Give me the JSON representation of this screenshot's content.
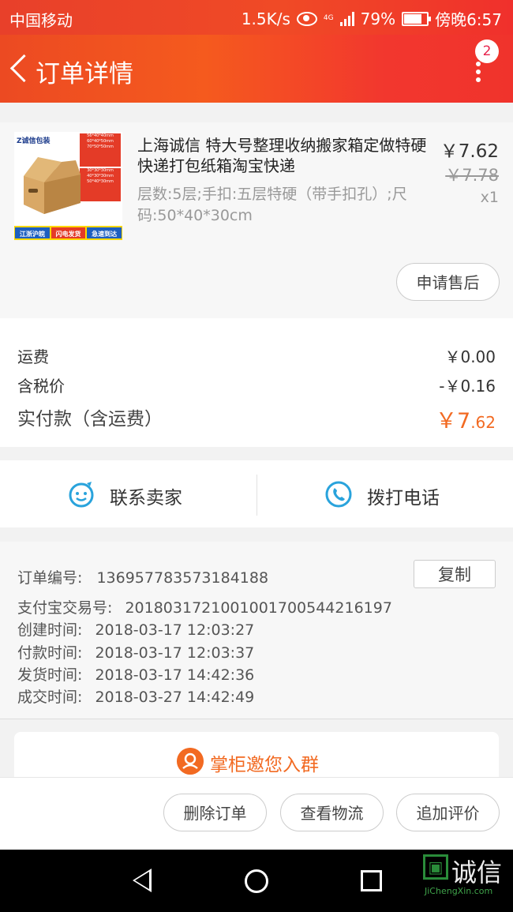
{
  "status_bar": {
    "carrier": "中国移动",
    "speed": "1.5K/s",
    "network": "4G",
    "battery": "79%",
    "time": "傍晚6:57"
  },
  "header": {
    "title": "订单详情",
    "notification_count": "2"
  },
  "product": {
    "image": {
      "brand": "Z诚信包装",
      "badges": [
        "江浙沪皖",
        "闪电发货",
        "急速到达"
      ]
    },
    "name": "上海诚信 特大号整理收纳搬家箱定做特硬快递打包纸箱淘宝快递",
    "sku": "层数:5层;手扣:五层特硬（带手扣孔）;尺码:50*40*30cm",
    "price": "￥7.62",
    "original_price": "￥7.78",
    "quantity": "x1",
    "after_sale_label": "申请售后"
  },
  "fees": {
    "shipping_label": "运费",
    "shipping_value": "￥0.00",
    "tax_label": "含税价",
    "tax_value": "-￥0.16",
    "total_label": "实付款（含运费）",
    "total_big": "￥7",
    "total_small": ".62"
  },
  "contact": {
    "seller_label": "联系卖家",
    "call_label": "拨打电话"
  },
  "order_info": {
    "order_no_label": "订单编号:",
    "order_no": "1369577835731841​88",
    "copy_label": "复制",
    "alipay_label": "支付宝交易号:",
    "alipay_no": "2018031721001001700544216197",
    "created_label": "创建时间:",
    "created": "2018-03-17 12:03:27",
    "paid_label": "付款时间:",
    "paid": "2018-03-17 12:03:37",
    "shipped_label": "发货时间:",
    "shipped": "2018-03-17 14:42:36",
    "closed_label": "成交时间:",
    "closed": "2018-03-27 14:42:49"
  },
  "group_banner": {
    "label": "掌柜邀您入群"
  },
  "actions": {
    "delete_label": "删除订单",
    "logistics_label": "查看物流",
    "review_label": "追加评价"
  },
  "watermark": {
    "main": "诚信",
    "url": "JiChengXin.com"
  },
  "colors": {
    "accent": "#f26a22",
    "header": "#f04a26"
  }
}
